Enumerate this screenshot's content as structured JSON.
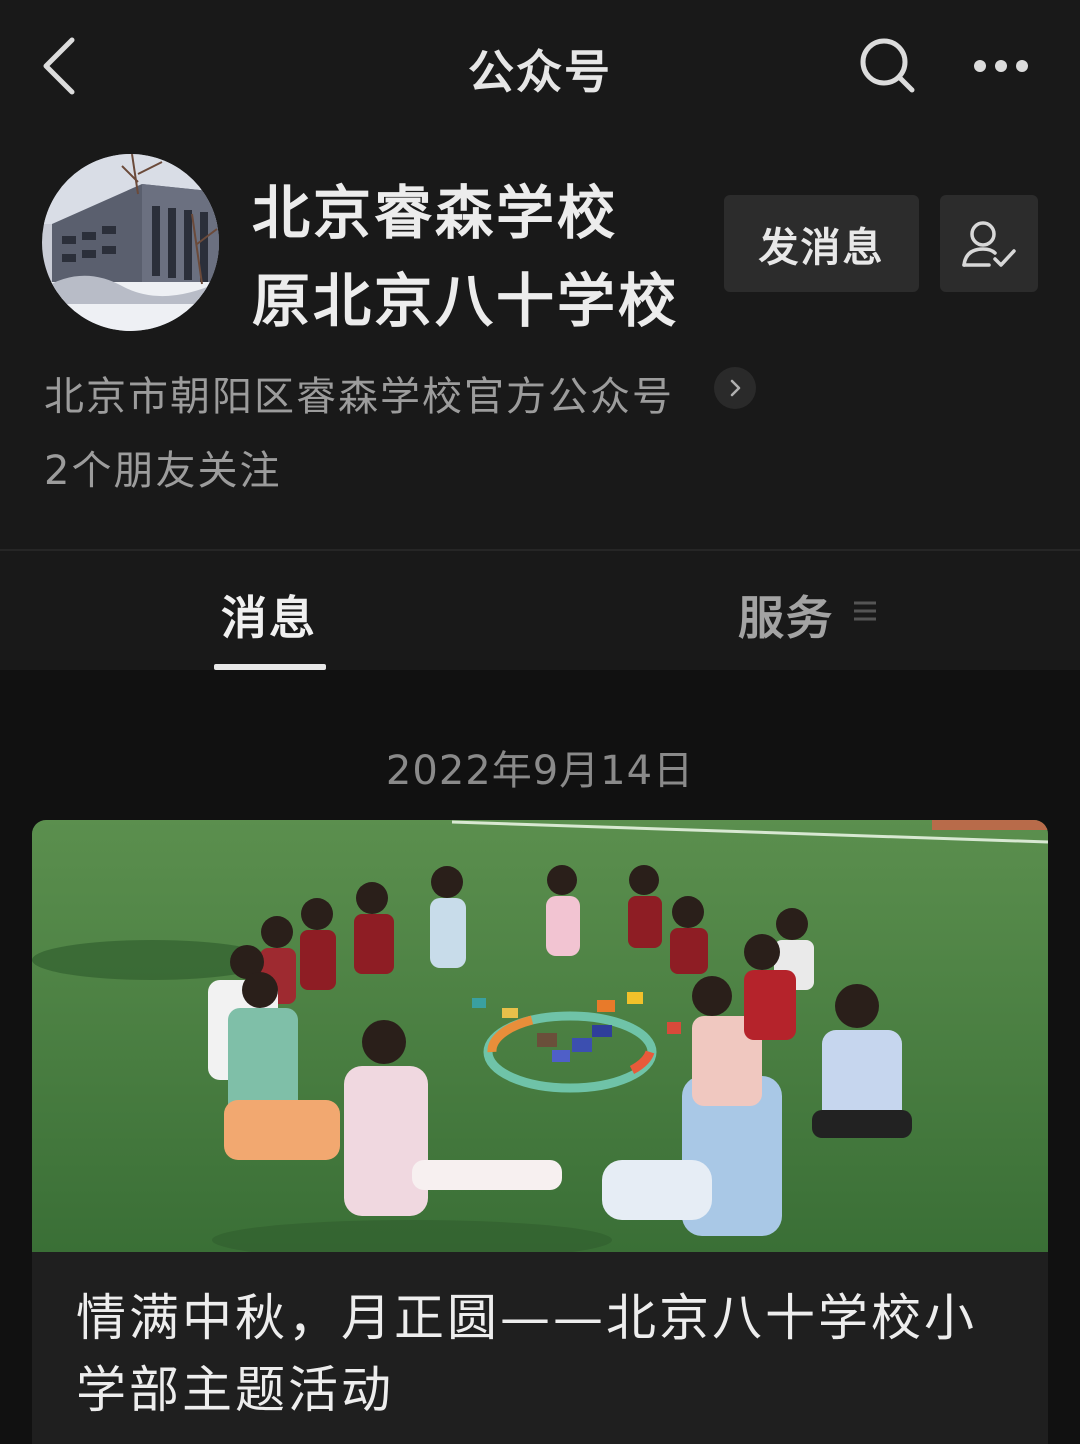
{
  "nav": {
    "title": "公众号",
    "back_icon": "chevron-left-icon",
    "search_icon": "search-icon",
    "more_icon": "more-horizontal-icon"
  },
  "profile": {
    "name_line1": "北京睿森学校",
    "name_line2": "原北京八十学校",
    "send_message_label": "发消息",
    "followed_icon": "user-check-icon",
    "description": "北京市朝阳区睿森学校官方公众号",
    "friends_following": "2个朋友关注"
  },
  "tabs": [
    {
      "label": "消息",
      "active": true
    },
    {
      "label": "服务",
      "active": false
    }
  ],
  "messages": [
    {
      "date": "2022年9月14日",
      "title": "情满中秋，月正圆——北京八十学校小学部主题活动"
    }
  ],
  "colors": {
    "background": "#191919",
    "list_background": "#111111",
    "button_background": "#2c2c2c",
    "grass": "#3f7a3a"
  }
}
